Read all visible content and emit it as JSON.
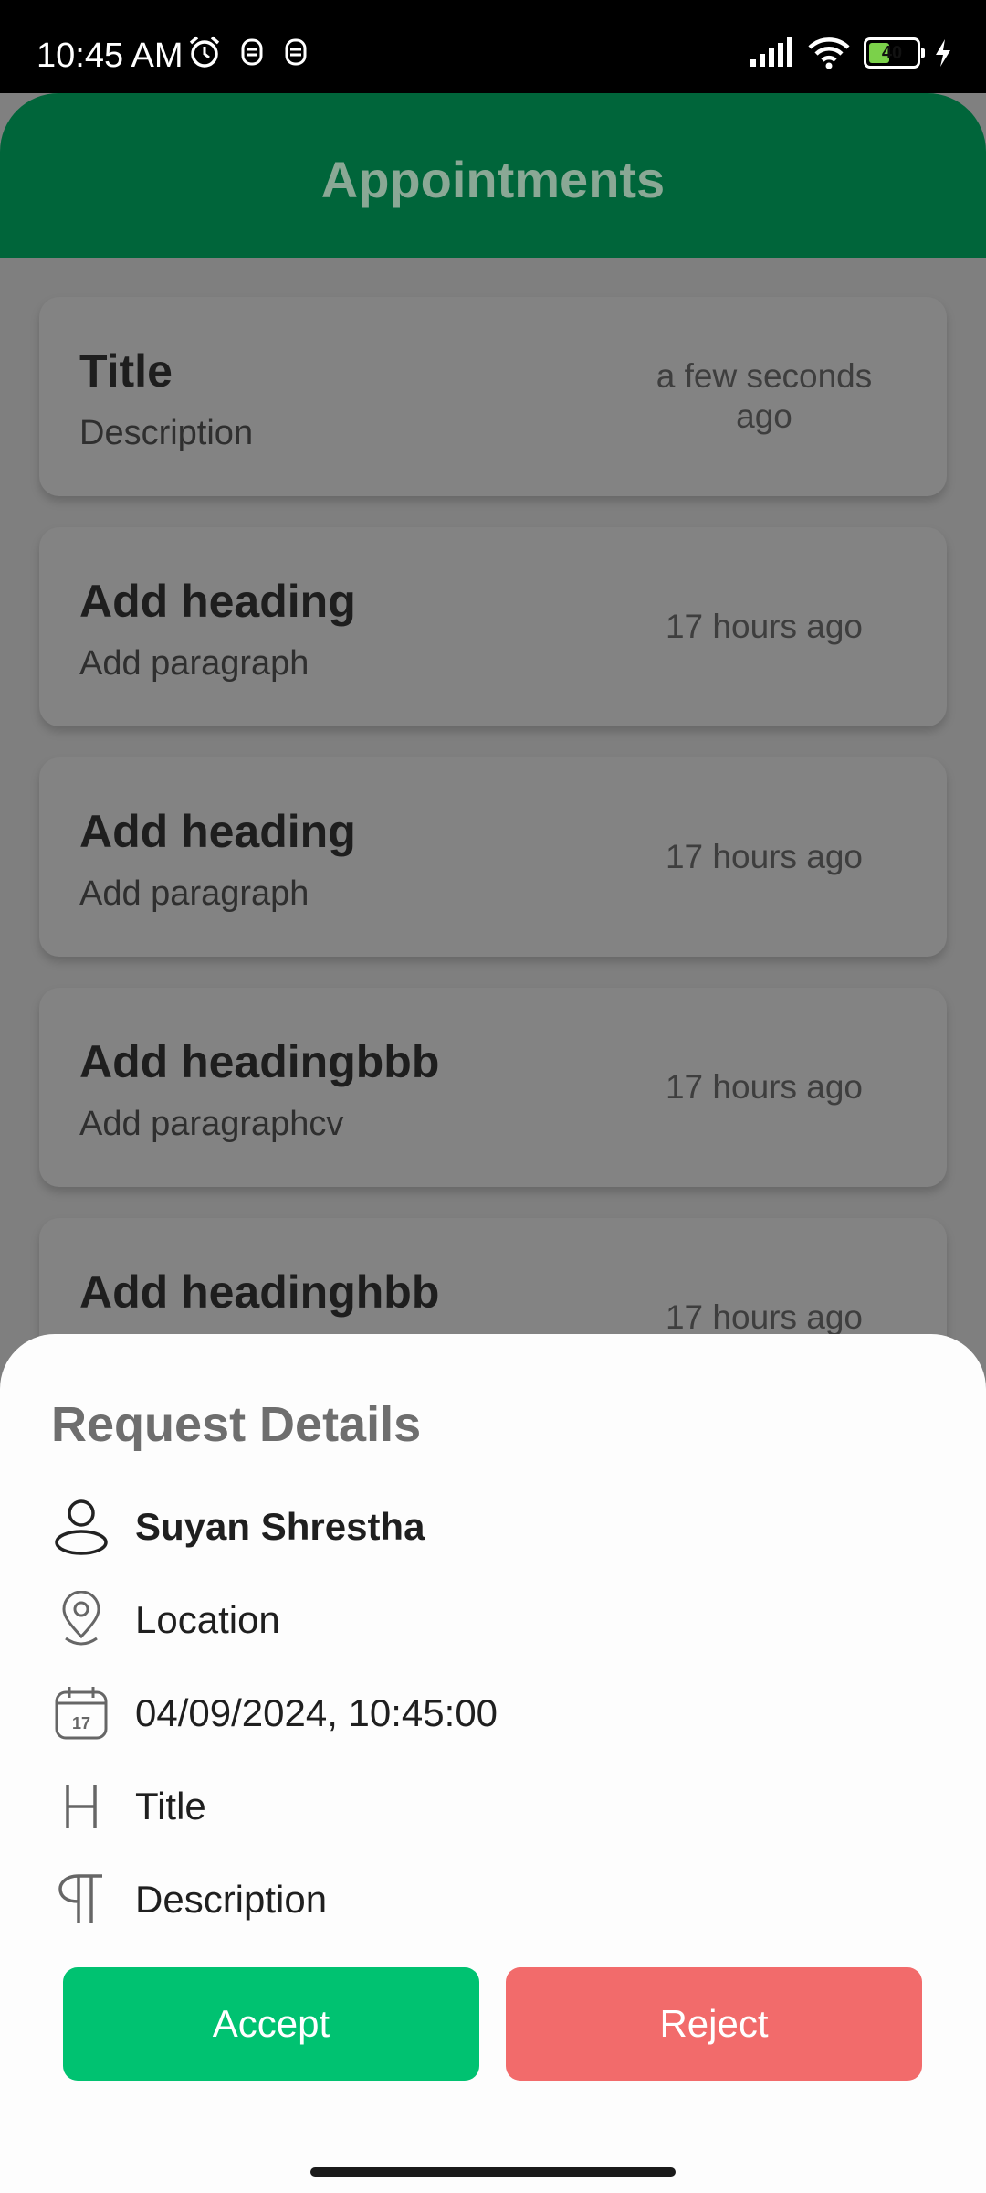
{
  "status_bar": {
    "time": "10:45 AM",
    "battery": "40"
  },
  "header": {
    "title": "Appointments"
  },
  "appointments": [
    {
      "title": "Title",
      "description": "Description",
      "time": "a few seconds ago"
    },
    {
      "title": "Add heading",
      "description": "Add paragraph",
      "time": "17 hours ago"
    },
    {
      "title": "Add heading",
      "description": "Add paragraph",
      "time": "17 hours ago"
    },
    {
      "title": "Add headingbbb",
      "description": "Add paragraphcv",
      "time": "17 hours ago"
    },
    {
      "title": "Add headinghbb",
      "description": "",
      "time": "17 hours ago"
    }
  ],
  "request_details": {
    "title": "Request Details",
    "name": "Suyan Shrestha",
    "location": "Location",
    "datetime": "04/09/2024, 10:45:00",
    "calendar_day": "17",
    "heading": "Title",
    "description": "Description",
    "accept_label": "Accept",
    "reject_label": "Reject"
  },
  "colors": {
    "header_green": "#00653a",
    "accept_green": "#00c271",
    "reject_red": "#f26b6b"
  },
  "icons": [
    "alarm-icon",
    "notification-icon",
    "signal-icon",
    "wifi-icon",
    "battery-icon",
    "charging-icon",
    "person-icon",
    "location-pin-icon",
    "calendar-icon",
    "heading-icon",
    "paragraph-icon"
  ]
}
